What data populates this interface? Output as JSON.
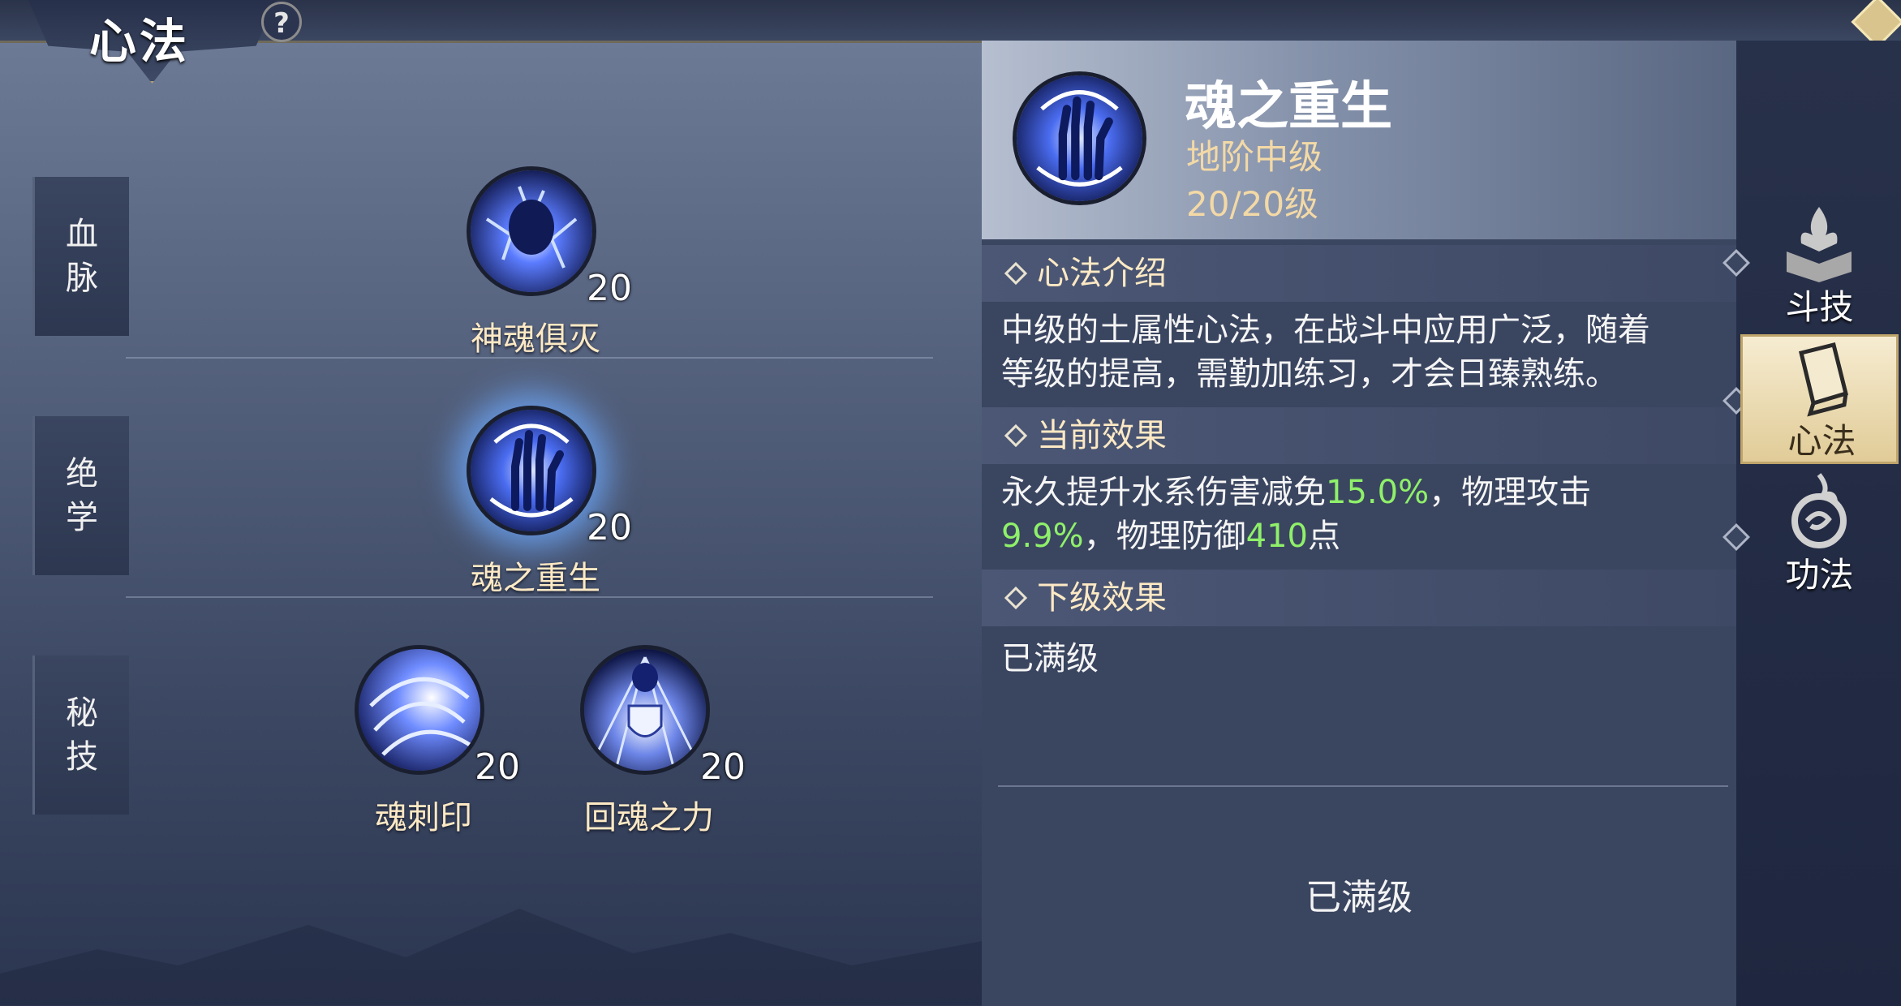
{
  "header": {
    "title": "心法",
    "help_label": "?"
  },
  "rows": [
    {
      "label_chars": [
        "血",
        "脉"
      ],
      "skills": [
        {
          "name": "神魂俱灭",
          "level": "20"
        }
      ]
    },
    {
      "label_chars": [
        "绝",
        "学"
      ],
      "skills": [
        {
          "name": "魂之重生",
          "level": "20"
        }
      ]
    },
    {
      "label_chars": [
        "秘",
        "技"
      ],
      "skills": [
        {
          "name": "魂刺印",
          "level": "20"
        },
        {
          "name": "回魂之力",
          "level": "20"
        }
      ]
    }
  ],
  "detail": {
    "title": "魂之重生",
    "rank": "地阶中级",
    "level": "20/20级",
    "intro_heading": "心法介绍",
    "intro_line1": "中级的土属性心法，在战斗中应用广泛，随着",
    "intro_line2": "等级的提高，需勤加练习，才会日臻熟练。",
    "current_heading": "当前效果",
    "current_effect": {
      "part1": "永久提升水系伤害减免",
      "value1": "15.0%",
      "part2": "，物理攻击",
      "value2": "9.9%",
      "part3": "，物理防御",
      "value3": "410",
      "part4": "点"
    },
    "next_heading": "下级效果",
    "next_effect": "已满级",
    "bottom_status": "已满级"
  },
  "nav": [
    {
      "label": "斗技",
      "icon": "flame-book-icon",
      "active": false
    },
    {
      "label": "心法",
      "icon": "book-icon",
      "active": true
    },
    {
      "label": "功法",
      "icon": "flame-swirl-icon",
      "active": false
    }
  ],
  "colors": {
    "highlight": "#8ff06a",
    "gold_text": "#fde9c4",
    "active_tab": "#f6ecd1"
  }
}
